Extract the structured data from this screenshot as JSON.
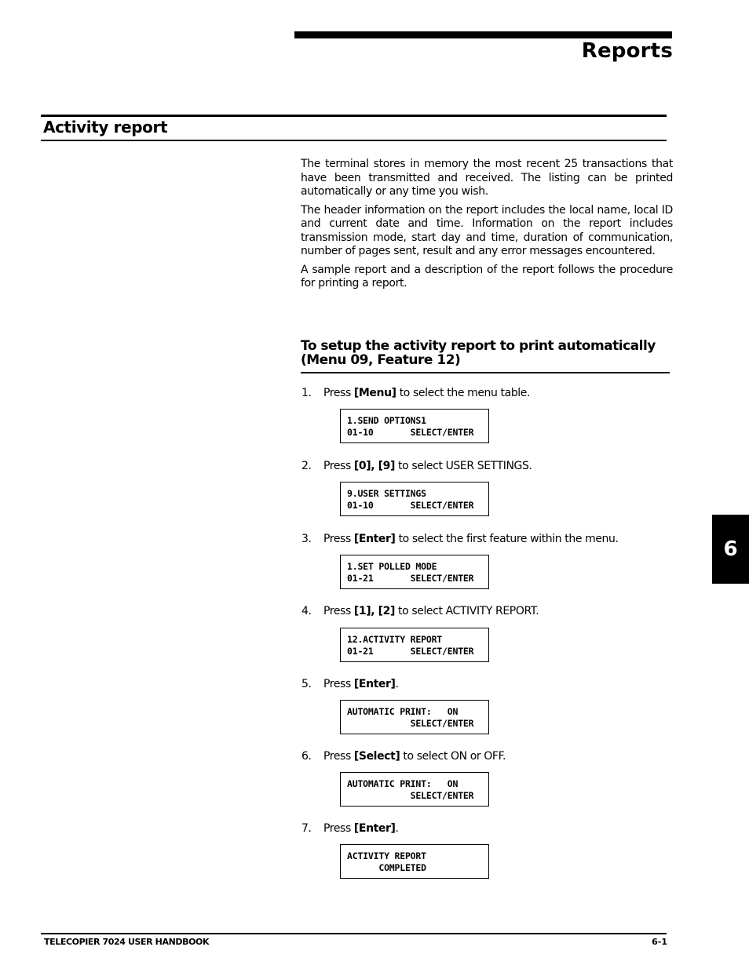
{
  "header": {
    "chapter_title": "Reports"
  },
  "section": {
    "title": "Activity report",
    "paragraphs": [
      "The terminal stores in memory the most recent 25 transactions that have been transmitted and received.  The listing can be printed automatically or any time you wish.",
      "The header information on the report includes the local name, local ID and current date and time.  Information on the report includes transmission mode, start day and time, duration of communication, number of pages sent, result and any error messages encountered.",
      "A sample report and a description of the report follows the procedure for printing a report."
    ]
  },
  "procedure": {
    "title_line1": "To setup the activity report to print automatically",
    "title_line2": "(Menu 09, Feature 12)",
    "steps": [
      {
        "num": "1.",
        "pre": "Press ",
        "key": "[Menu]",
        "post": " to select the menu table.",
        "display": [
          "1.SEND OPTIONS1",
          "01-10       SELECT/ENTER"
        ]
      },
      {
        "num": "2.",
        "pre": "Press ",
        "key": "[0], [9]",
        "post": " to select USER SETTINGS.",
        "display": [
          "9.USER SETTINGS",
          "01-10       SELECT/ENTER"
        ]
      },
      {
        "num": "3.",
        "pre": "Press ",
        "key": "[Enter]",
        "post": " to select the first feature within the menu.",
        "display": [
          "1.SET POLLED MODE",
          "01-21       SELECT/ENTER"
        ]
      },
      {
        "num": "4.",
        "pre": "Press ",
        "key": "[1], [2]",
        "post": " to select ACTIVITY REPORT.",
        "display": [
          "12.ACTIVITY REPORT",
          "01-21       SELECT/ENTER"
        ]
      },
      {
        "num": "5.",
        "pre": "Press ",
        "key": "[Enter]",
        "post": ".",
        "display": [
          "AUTOMATIC PRINT:   ON",
          "            SELECT/ENTER"
        ]
      },
      {
        "num": "6.",
        "pre": "Press ",
        "key": "[Select]",
        "post": " to select ON or OFF.",
        "display": [
          "AUTOMATIC PRINT:   ON",
          "            SELECT/ENTER"
        ]
      },
      {
        "num": "7.",
        "pre": "Press ",
        "key": "[Enter]",
        "post": ".",
        "display": [
          "ACTIVITY REPORT",
          "      COMPLETED"
        ]
      }
    ]
  },
  "chapter_tab": "6",
  "footer": {
    "left": "TELECOPIER 7024 USER HANDBOOK",
    "right": "6-1"
  }
}
